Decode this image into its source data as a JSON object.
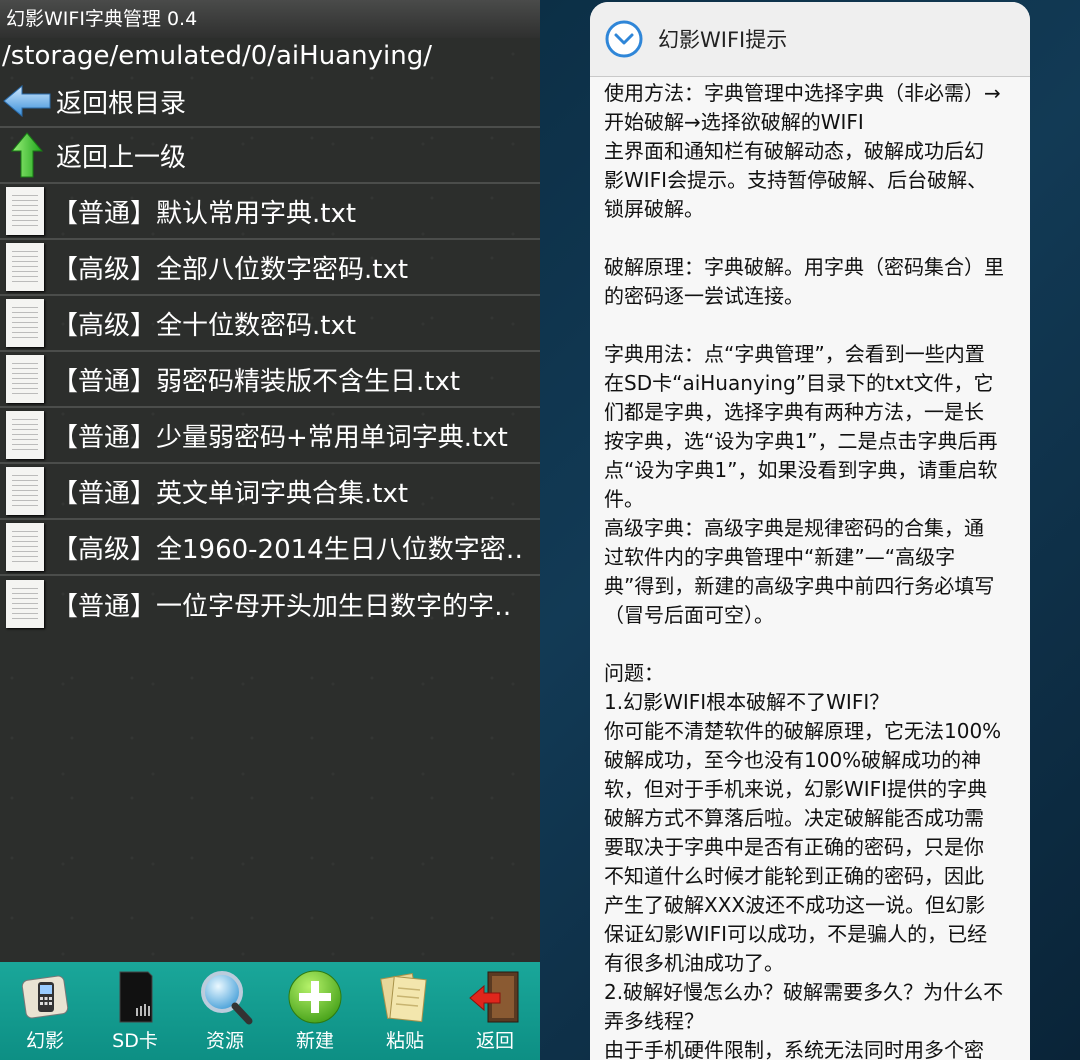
{
  "left": {
    "title": "幻影WIFI字典管理 0.4",
    "path": "/storage/emulated/0/aiHuanying/",
    "nav": [
      {
        "label": "返回根目录",
        "icon": "back-arrow-icon"
      },
      {
        "label": "返回上一级",
        "icon": "up-arrow-icon"
      }
    ],
    "files": [
      "【普通】默认常用字典.txt",
      "【高级】全部八位数字密码.txt",
      "【高级】全十位数密码.txt",
      "【普通】弱密码精装版不含生日.txt",
      "【普通】少量弱密码+常用单词字典.txt",
      "【普通】英文单词字典合集.txt",
      "【高级】全1960-2014生日八位数字密‥",
      "【普通】一位字母开头加生日数字的字‥"
    ],
    "toolbar": [
      {
        "label": "幻影",
        "icon": "phone-icon"
      },
      {
        "label": "SD卡",
        "icon": "sd-card-icon"
      },
      {
        "label": "资源",
        "icon": "magnifier-icon"
      },
      {
        "label": "新建",
        "icon": "plus-icon"
      },
      {
        "label": "粘贴",
        "icon": "paste-icon"
      },
      {
        "label": "返回",
        "icon": "exit-door-icon"
      }
    ]
  },
  "dialog": {
    "title": "幻影WIFI提示",
    "body": "使用方法：字典管理中选择字典（非必需）→\n开始破解→选择欲破解的WIFI\n主界面和通知栏有破解动态，破解成功后幻\n影WIFI会提示。支持暂停破解、后台破解、\n锁屏破解。\n\n破解原理：字典破解。用字典（密码集合）里\n的密码逐一尝试连接。\n\n字典用法：点“字典管理”，会看到一些内置\n在SD卡“aiHuanying”目录下的txt文件，它\n们都是字典，选择字典有两种方法，一是长\n按字典，选“设为字典1”，二是点击字典后再\n点“设为字典1”，如果没看到字典，请重启软\n件。\n高级字典：高级字典是规律密码的合集，通\n过软件内的字典管理中“新建”—“高级字\n典”得到，新建的高级字典中前四行务必填写\n（冒号后面可空）。\n\n问题：\n1.幻影WIFI根本破解不了WIFI？\n你可能不清楚软件的破解原理，它无法100%\n破解成功，至今也没有100%破解成功的神\n软，但对于手机来说，幻影WIFI提供的字典\n破解方式不算落后啦。决定破解能否成功需\n要取决于字典中是否有正确的密码，只是你\n不知道什么时候才能轮到正确的密码，因此\n产生了破解XXX波还不成功这一说。但幻影\n保证幻影WIFI可以成功，不是骗人的，已经\n有很多机油成功了。\n2.破解好慢怎么办？破解需要多久？为什么不\n弄多线程？\n由于手机硬件限制，系统无法同时用多个密"
  }
}
